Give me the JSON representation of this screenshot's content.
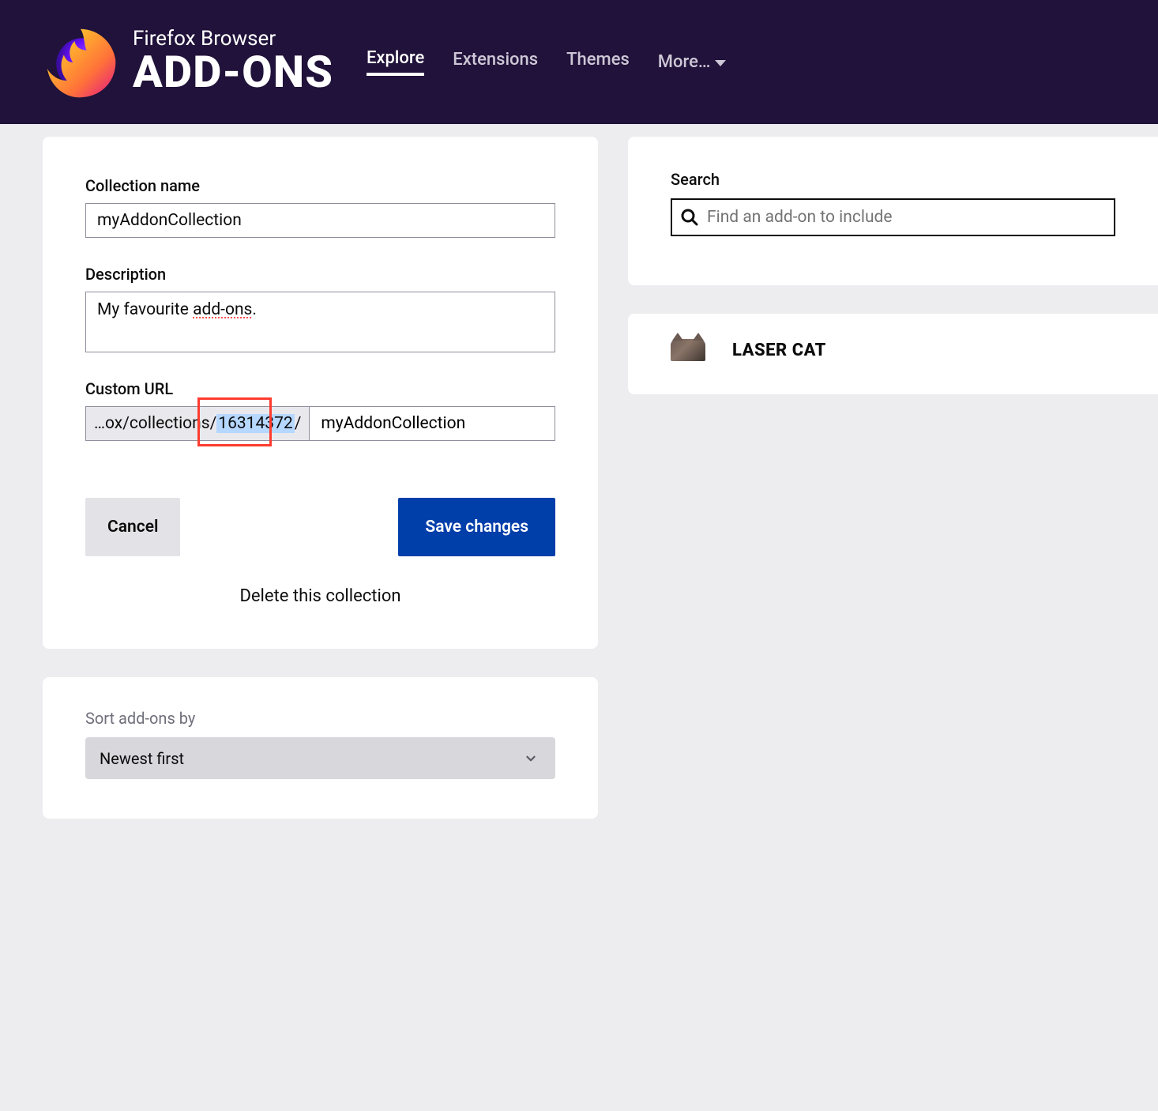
{
  "header": {
    "brand_top": "Firefox Browser",
    "brand_main": "ADD-ONS",
    "nav": {
      "explore": "Explore",
      "extensions": "Extensions",
      "themes": "Themes",
      "more": "More…"
    }
  },
  "form": {
    "name_label": "Collection name",
    "name_value": "myAddonCollection",
    "desc_label": "Description",
    "desc_prefix": "My favourite ",
    "desc_spell": "add-ons",
    "desc_suffix": ".",
    "url_label": "Custom URL",
    "url_prefix_a": "…ox/collections/",
    "url_id": "16314372",
    "url_prefix_b": "/",
    "url_value": "myAddonCollection",
    "cancel": "Cancel",
    "save": "Save changes",
    "delete": "Delete this collection"
  },
  "sort": {
    "label": "Sort add-ons by",
    "value": "Newest first"
  },
  "search": {
    "label": "Search",
    "placeholder": "Find an add-on to include"
  },
  "result": {
    "name": "LASER CAT"
  }
}
